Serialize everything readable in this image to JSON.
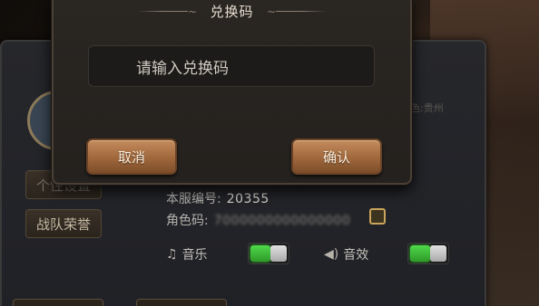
{
  "modal": {
    "title": "兑换码",
    "input_placeholder": "请输入兑换码",
    "cancel_label": "取消",
    "confirm_label": "确认"
  },
  "side_buttons": {
    "personal_settings": "个性设置",
    "team_honor": "战队荣誉"
  },
  "info": {
    "server_label": "本服编号:",
    "server_value": "20355",
    "role_label": "角色码:",
    "role_value": "7000000000000000"
  },
  "settings": {
    "music_label": "音乐",
    "music_on": true,
    "sfx_label": "音效",
    "sfx_on": true
  },
  "faint": {
    "region_text": "色:贵州"
  },
  "icons": {
    "music": "music-note-icon",
    "sound": "speaker-icon",
    "copy": "copy-icon"
  },
  "colors": {
    "button_brown": "#a26a3e",
    "toggle_green": "#3fbf3a"
  }
}
